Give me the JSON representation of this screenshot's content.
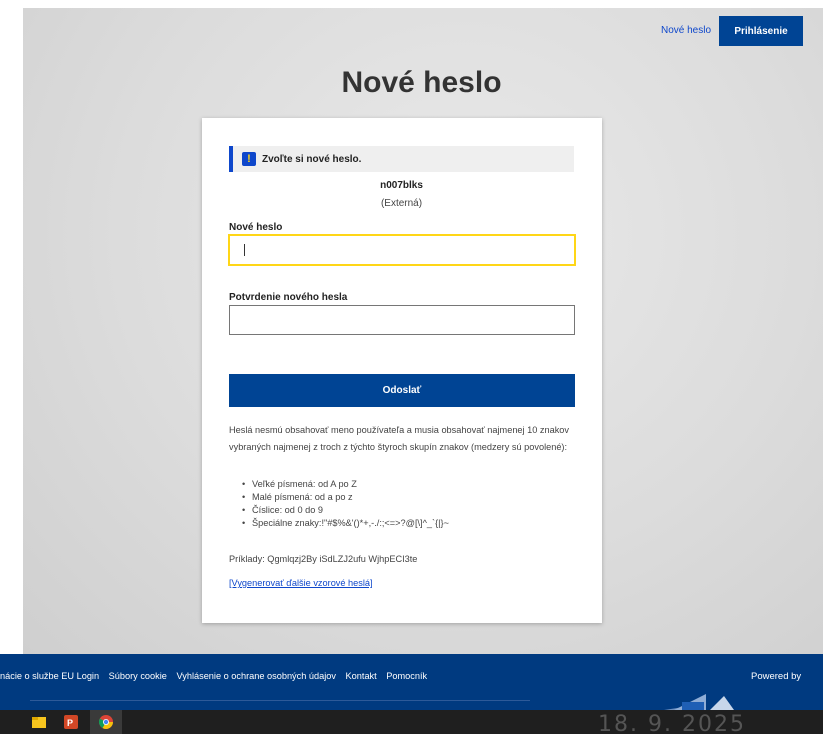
{
  "header": {
    "new_password_link": "Nové heslo",
    "login_button": "Prihlásenie"
  },
  "page_title": "Nové heslo",
  "form": {
    "notice": "Zvoľte si nové heslo.",
    "username": "n007blks",
    "user_type": "(Externá)",
    "new_password_label": "Nové heslo",
    "new_password_value": "",
    "confirm_label": "Potvrdenie nového hesla",
    "confirm_value": "",
    "submit_label": "Odoslať",
    "rules_intro": "Heslá nesmú obsahovať meno používateľa a musia obsahovať najmenej 10 znakov vybraných najmenej z troch z týchto štyroch skupín znakov (medzery sú povolené):",
    "rules": [
      "Veľké písmená: od A po Z",
      "Malé písmená: od a po z",
      "Číslice: od 0 do 9",
      "Špeciálne znaky:!\"#$%&'()*+,-./:;<=>?@[\\]^_`{|}~"
    ],
    "examples": "Príklady: Qgmlqzj2By iSdLZJ2ufu WjhpECI3te",
    "generate_link": "[Vygenerovať ďalšie vzorové heslá]"
  },
  "footer": {
    "links": [
      "nácie o službe EU Login",
      "Súbory cookie",
      "Vyhlásenie o ochrane osobných údajov",
      "Kontakt",
      "Pomocník"
    ],
    "powered_by": "Powered by"
  },
  "overlay_date": "18. 9. 2025",
  "colors": {
    "brand_blue": "#004494",
    "link_blue": "#0e47cb",
    "focus_yellow": "#ffd617",
    "footer_blue": "#003a80"
  },
  "taskbar": {
    "icons": [
      "file-explorer-icon",
      "powerpoint-icon",
      "chrome-icon"
    ]
  }
}
